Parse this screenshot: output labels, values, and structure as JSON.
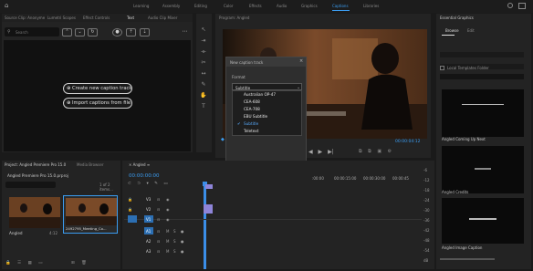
{
  "topbar": {
    "tabs": [
      "Learning",
      "Assembly",
      "Editing",
      "Color",
      "Effects",
      "Audio",
      "Graphics",
      "Captions",
      "Libraries"
    ],
    "active_tab": "Captions"
  },
  "source_panel": {
    "tabs": [
      "Source Clip: Anonyme",
      "Lumetri Scopes",
      "Effect Controls",
      "Text",
      "Audio Clip Mixer"
    ],
    "search_placeholder": "Search",
    "create_button": "Create new caption track",
    "import_button": "Import captions from file"
  },
  "program": {
    "title": "Program: Angled",
    "timecode": "00:00:04:12"
  },
  "dialog": {
    "title": "New caption track",
    "format_label": "Format",
    "selected_format": "Subtitle",
    "options": [
      "Australian OP-47",
      "CEA-608",
      "CEA-708",
      "EBU Subtitle",
      "Subtitle",
      "Teletext"
    ],
    "ok_label": "OK",
    "cancel_label": "Cancel"
  },
  "project": {
    "tabs": [
      "Project: Angled Premiere Pro 15.0",
      "Media Browser"
    ],
    "filename": "Angled Premiere Pro 15.0.prproj",
    "item_count": "1 of 2 items...",
    "items": [
      {
        "name": "Angled",
        "duration": "4:12"
      },
      {
        "name": "2492795_Meeting_Co...",
        "duration": "4:12"
      }
    ]
  },
  "timeline": {
    "timecode": "00:00:00:00",
    "ruler": [
      ":00:00",
      "00:00:15:00",
      "00:00:30:00",
      "00:00:45"
    ],
    "video_tracks": [
      "V3",
      "V2",
      "V1"
    ],
    "audio_tracks": [
      "A1",
      "A2",
      "A3"
    ]
  },
  "essential_graphics": {
    "tabs": [
      "Essential Graphics",
      "Edit"
    ],
    "local_templates": "Local Templates Folder",
    "templates": [
      "Angled Coming Up Next",
      "Angled Credits",
      "Angled Image Caption"
    ]
  },
  "audio_meter": {
    "scale": [
      "-6",
      "-12",
      "-18",
      "-24",
      "-30",
      "-36",
      "-42",
      "-48",
      "-54",
      "dB"
    ]
  },
  "colors": {
    "accent": "#3b9cf0",
    "playhead": "#3b8ee8",
    "clip": "#8e84d8"
  }
}
